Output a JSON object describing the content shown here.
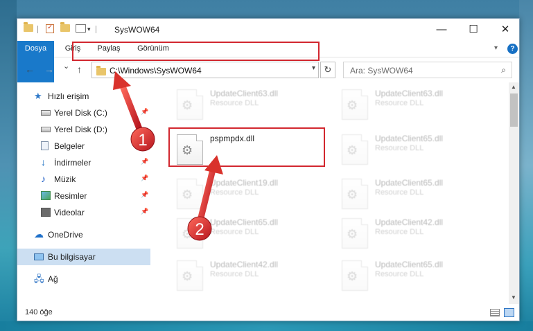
{
  "window": {
    "title": "SysWOW64",
    "minimize": "—",
    "maximize": "☐",
    "close": "✕"
  },
  "ribbon": {
    "tabs": [
      "Dosya",
      "Giriş",
      "Paylaş",
      "Görünüm"
    ],
    "collapse_icon": "chevron-down",
    "help": "?"
  },
  "nav": {
    "back": "←",
    "forward": "→",
    "recent": "⌄",
    "up": "↑",
    "address": "C:\\Windows\\SysWOW64",
    "refresh": "↻",
    "search_placeholder": "Ara: SysWOW64"
  },
  "sidebar": {
    "items": [
      {
        "label": "Hızlı erişim",
        "icon": "star-icon"
      },
      {
        "label": "Yerel Disk (C:)",
        "icon": "disk-icon",
        "pinned": true
      },
      {
        "label": "Yerel Disk (D:)",
        "icon": "disk-icon"
      },
      {
        "label": "Belgeler",
        "icon": "documents-icon"
      },
      {
        "label": "İndirmeler",
        "icon": "downloads-icon",
        "pinned": true
      },
      {
        "label": "Müzik",
        "icon": "music-icon",
        "pinned": true
      },
      {
        "label": "Resimler",
        "icon": "pictures-icon",
        "pinned": true
      },
      {
        "label": "Videolar",
        "icon": "videos-icon",
        "pinned": true
      },
      {
        "label": "OneDrive",
        "icon": "cloud-icon"
      },
      {
        "label": "Bu bilgisayar",
        "icon": "computer-icon",
        "selected": true
      },
      {
        "label": "Ağ",
        "icon": "network-icon"
      }
    ]
  },
  "files": [
    {
      "name": "UpdateClient63.dll",
      "desc": "Resource DLL",
      "faded": true
    },
    {
      "name": "UpdateClient63.dll",
      "desc": "Resource DLL",
      "faded": true
    },
    {
      "name": "pspmpdx.dll",
      "desc": "",
      "faded": false
    },
    {
      "name": "UpdateClient65.dll",
      "desc": "Resource DLL",
      "faded": true
    },
    {
      "name": "UpdateClient19.dll",
      "desc": "Resource DLL",
      "faded": true
    },
    {
      "name": "UpdateClient65.dll",
      "desc": "Resource DLL",
      "faded": true
    },
    {
      "name": "UpdateClient65.dll",
      "desc": "Resource DLL",
      "faded": true
    },
    {
      "name": "UpdateClient42.dll",
      "desc": "Resource DLL",
      "faded": true
    },
    {
      "name": "UpdateClient42.dll",
      "desc": "Resource DLL",
      "faded": true
    },
    {
      "name": "UpdateClient65.dll",
      "desc": "Resource DLL",
      "faded": true
    }
  ],
  "status": {
    "count": "140 öğe"
  },
  "annotations": {
    "step1": "1",
    "step2": "2",
    "color": "#d2272f"
  }
}
